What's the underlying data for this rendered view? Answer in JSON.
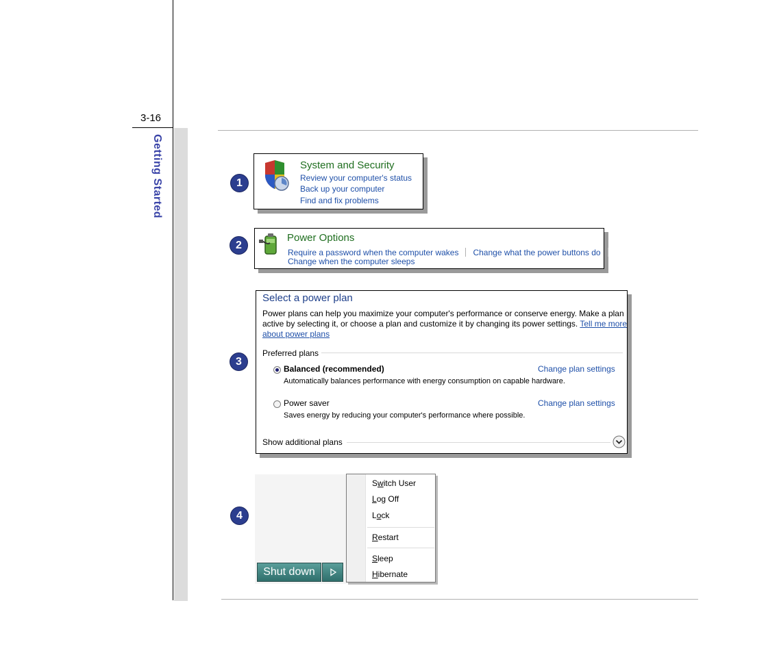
{
  "page": {
    "number": "3-16",
    "side_title": "Getting Started"
  },
  "badges": [
    "1",
    "2",
    "3",
    "4"
  ],
  "system_security": {
    "title": "System and Security",
    "links": [
      "Review your computer's status",
      "Back up your computer",
      "Find and fix problems"
    ]
  },
  "power_options": {
    "title": "Power Options",
    "link1": "Require a password when the computer wakes",
    "link2": "Change what the power buttons do",
    "link3": "Change when the computer sleeps"
  },
  "power_plan": {
    "title": "Select a power plan",
    "desc_line1": "Power plans can help you maximize your computer's performance or conserve energy. Make a plan",
    "desc_line2": "active by selecting it, or choose a plan and customize it by changing its power settings.",
    "tell_more_1": "Tell me more",
    "tell_more_2": "about power plans",
    "preferred_label": "Preferred plans",
    "plans": [
      {
        "name": "Balanced (recommended)",
        "selected": true,
        "change_link": "Change plan settings",
        "desc": "Automatically balances performance with energy consumption on capable hardware."
      },
      {
        "name": "Power saver",
        "selected": false,
        "change_link": "Change plan settings",
        "desc": "Saves energy by reducing your computer's performance where possible."
      }
    ],
    "show_additional": "Show additional plans"
  },
  "shutdown_menu": {
    "items": [
      {
        "pre": "S",
        "key": "w",
        "post": "itch User"
      },
      {
        "pre": "",
        "key": "L",
        "post": "og Off"
      },
      {
        "pre": "L",
        "key": "o",
        "post": "ck"
      },
      {
        "pre": "",
        "key": "R",
        "post": "estart"
      },
      {
        "pre": "",
        "key": "S",
        "post": "leep"
      },
      {
        "pre": "",
        "key": "H",
        "post": "ibernate"
      }
    ],
    "button_label": "Shut down"
  },
  "colors": {
    "badge": "#2c3e8f",
    "side_title": "#3a44a8",
    "link": "#1e4fa8",
    "green_title": "#1f6e1f"
  }
}
